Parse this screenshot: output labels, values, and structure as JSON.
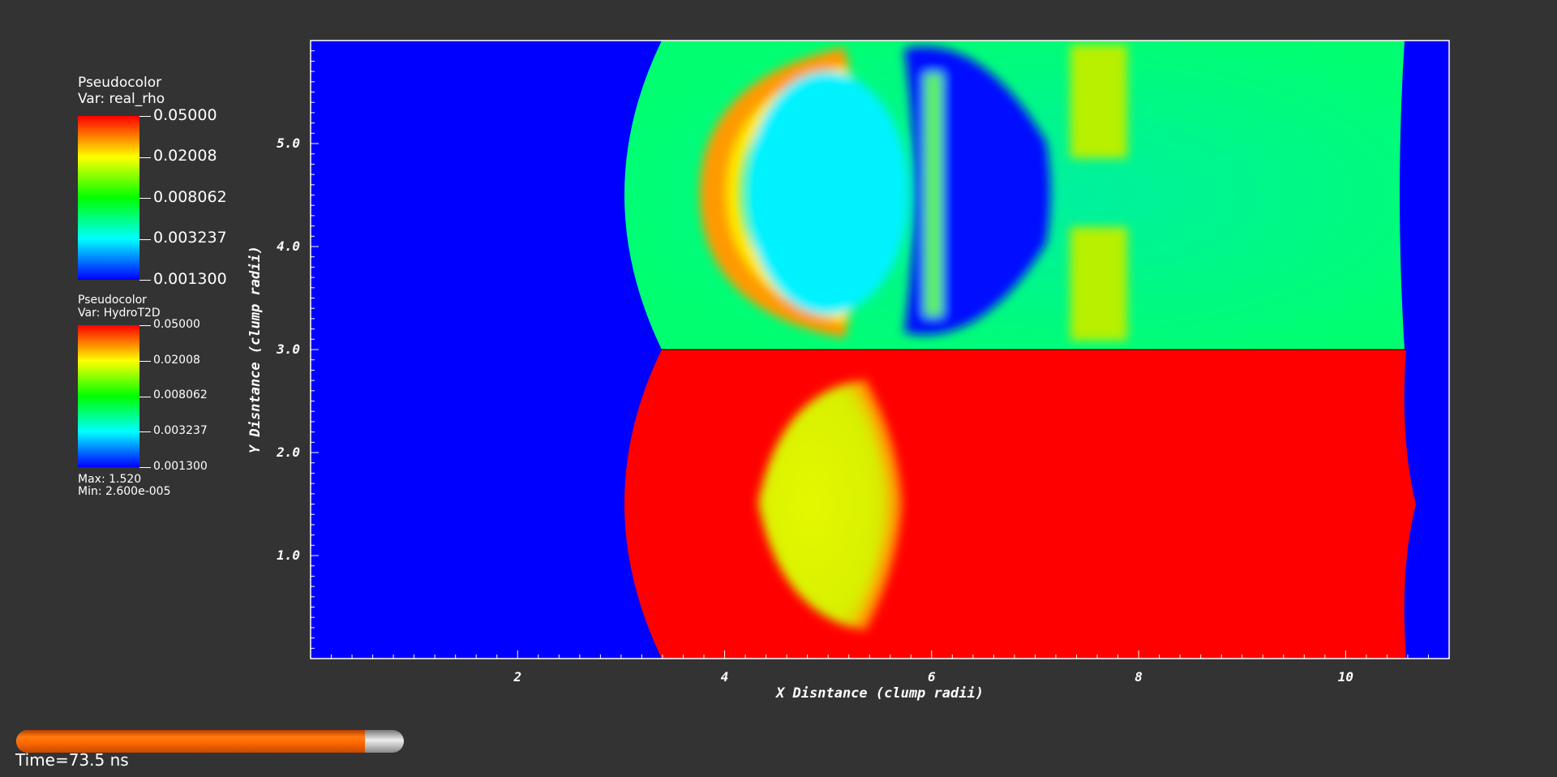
{
  "legend_top": {
    "title": "Pseudocolor",
    "var_label": "Var: real_rho",
    "ticks": [
      "0.05000",
      "0.02008",
      "0.008062",
      "0.003237",
      "0.001300"
    ]
  },
  "legend_bottom": {
    "title": "Pseudocolor",
    "var_label": "Var: HydroT2D",
    "ticks": [
      "0.05000",
      "0.02008",
      "0.008062",
      "0.003237",
      "0.001300"
    ],
    "max_label": "Max:  1.520",
    "min_label": "Min:  2.600e-005"
  },
  "time": {
    "label": "Time=73.5 ns",
    "progress_fraction": 0.9
  },
  "chart_data": {
    "type": "heatmap",
    "xlabel": "X Disntance (clump radii)",
    "ylabel": "Y Disntance (clump radii)",
    "xlim": [
      0,
      11
    ],
    "ylim": [
      0,
      6
    ],
    "x_ticks": [
      2,
      4,
      6,
      8,
      10
    ],
    "x_tick_labels": [
      "2",
      "4",
      "6",
      "8",
      "10"
    ],
    "y_ticks": [
      1.0,
      2.0,
      3.0,
      4.0,
      5.0
    ],
    "y_tick_labels": [
      "1.0",
      "2.0",
      "3.0",
      "4.0",
      "5.0"
    ],
    "colormap": [
      "#ff0000",
      "#ffff00",
      "#00ff00",
      "#00ffff",
      "#0000ff"
    ],
    "colors": {
      "background_blue": "#0000ff",
      "upper_field": "#00ff80",
      "lower_field": "#ff0000",
      "clump_lower": "#d8f000",
      "cavity_upper": "#00f2ff"
    },
    "panels": [
      {
        "variable": "real_rho",
        "y_range": [
          3.0,
          6.0
        ],
        "min": 0.0013,
        "max": 0.05,
        "log_scale": true
      },
      {
        "variable": "HydroT2D",
        "y_range": [
          0.0,
          3.0
        ],
        "min": 0.0013,
        "max": 0.05,
        "log_scale": true
      }
    ],
    "shock_front_x": [
      3.0,
      3.4
    ],
    "right_boundary_x": 10.6,
    "clump_center": [
      5.0,
      1.5
    ]
  }
}
